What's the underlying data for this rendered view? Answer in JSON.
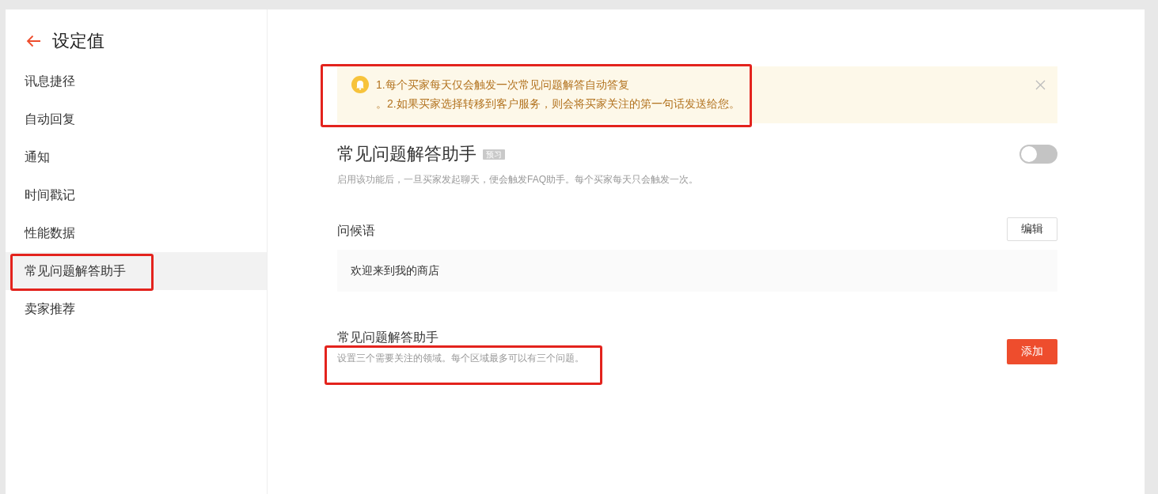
{
  "sidebar": {
    "title": "设定值",
    "items": [
      {
        "label": "讯息捷径",
        "selected": false,
        "highlighted": false
      },
      {
        "label": "自动回复",
        "selected": false,
        "highlighted": false
      },
      {
        "label": "通知",
        "selected": false,
        "highlighted": false
      },
      {
        "label": "时间戳记",
        "selected": false,
        "highlighted": false
      },
      {
        "label": "性能数据",
        "selected": false,
        "highlighted": false
      },
      {
        "label": "常见问题解答助手",
        "selected": true,
        "highlighted": true
      },
      {
        "label": "卖家推荐",
        "selected": false,
        "highlighted": false
      }
    ]
  },
  "notice": {
    "lines": [
      "1.每个买家每天仅会触发一次常见问题解答自动答复",
      "。2.如果买家选择转移到客户服务，则会将买家关注的第一句话发送给您。"
    ],
    "highlighted": true
  },
  "faq_toggle": {
    "title": "常见问题解答助手",
    "badge": "预习",
    "description": "启用该功能后，一旦买家发起聊天，便会触发FAQ助手。每个买家每天只会触发一次。",
    "on": false
  },
  "greeting": {
    "label": "问候语",
    "button": "编辑",
    "message": "欢迎来到我的商店"
  },
  "faq_section": {
    "title": "常见问题解答助手",
    "description": "设置三个需要关注的领域。每个区域最多可以有三个问题。",
    "button": "添加",
    "highlighted": true
  }
}
